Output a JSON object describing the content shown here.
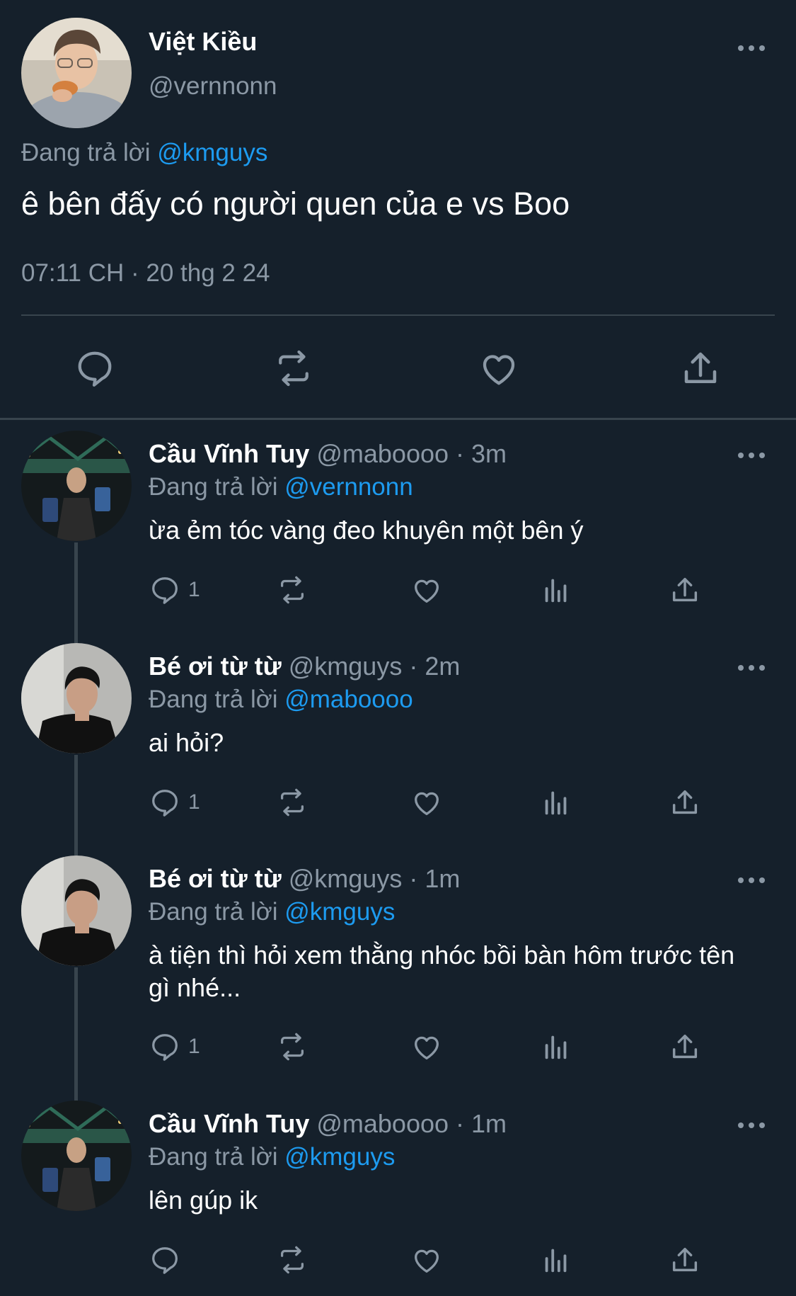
{
  "main_tweet": {
    "author_name": "Việt Kiều",
    "author_handle": "@vernnonn",
    "replying_prefix": "Đang trả lời",
    "replying_to": "@kmguys",
    "text": "ê bên đấy có người quen của e vs Boo",
    "timestamp": "07:11 CH · 20 thg 2 24"
  },
  "replies": [
    {
      "name": "Cầu Vĩnh Tuy",
      "meta": "@maboooo · 3m",
      "replying_prefix": "Đang trả lời",
      "replying_to": "@vernnonn",
      "text": "ừa ẻm tóc vàng đeo khuyên một bên ý",
      "reply_count": "1"
    },
    {
      "name": "Bé ơi từ từ",
      "meta": "@kmguys · 2m",
      "replying_prefix": "Đang trả lời",
      "replying_to": "@maboooo",
      "text": "ai hỏi?",
      "reply_count": "1"
    },
    {
      "name": "Bé ơi từ từ",
      "meta": "@kmguys · 1m",
      "replying_prefix": "Đang trả lời",
      "replying_to": "@kmguys",
      "text": "à tiện thì hỏi xem thằng nhóc bồi bàn hôm trước tên gì nhé...",
      "reply_count": "1"
    },
    {
      "name": "Cầu Vĩnh Tuy",
      "meta": "@maboooo · 1m",
      "replying_prefix": "Đang trả lời",
      "replying_to": "@kmguys",
      "text": "lên gúp ik",
      "reply_count": ""
    }
  ],
  "colors": {
    "background": "#15202b",
    "muted_text": "#8b98a5",
    "link": "#1d9bf0",
    "divider": "#38444d"
  },
  "icons": [
    "more-icon",
    "reply-icon",
    "retweet-icon",
    "like-icon",
    "views-icon",
    "share-icon"
  ]
}
